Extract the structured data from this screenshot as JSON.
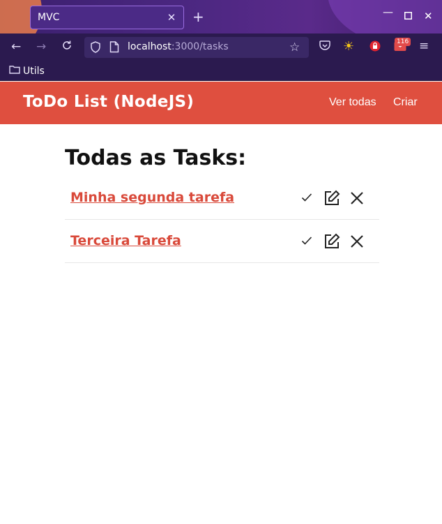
{
  "browser": {
    "tab_title": "MVC",
    "url_host": "localhost",
    "url_rest": ":3000/tasks",
    "badge_count": "116",
    "bookmarks": [
      {
        "label": "Utils"
      }
    ]
  },
  "app": {
    "brand": "ToDo List (NodeJS)",
    "nav": {
      "all": "Ver todas",
      "create": "Criar"
    },
    "accent": "#df4f3f"
  },
  "page": {
    "title": "Todas as Tasks:",
    "tasks": [
      {
        "title": "Minha segunda tarefa"
      },
      {
        "title": "Terceira Tarefa"
      }
    ]
  }
}
